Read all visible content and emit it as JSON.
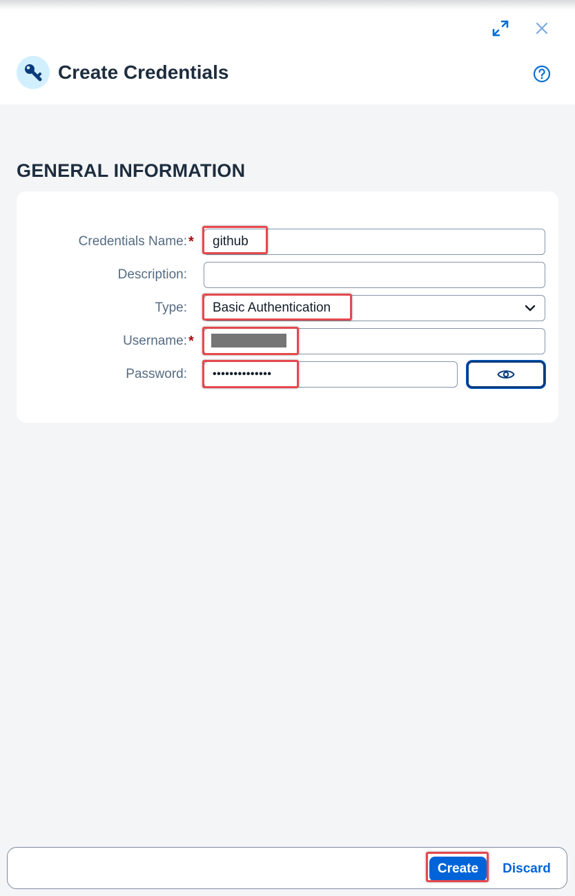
{
  "dialog": {
    "title": "Create Credentials",
    "icons": {
      "app": "key-icon",
      "expand": "expand-icon",
      "close": "close-icon",
      "help": "help-icon"
    }
  },
  "section": {
    "title": "GENERAL INFORMATION"
  },
  "form": {
    "credentials_name": {
      "label": "Credentials Name:",
      "required": "*",
      "value": "github"
    },
    "description": {
      "label": "Description:",
      "value": ""
    },
    "type": {
      "label": "Type:",
      "value": "Basic Authentication"
    },
    "username": {
      "label": "Username:",
      "required": "*"
    },
    "password": {
      "label": "Password:",
      "value_masked": "••••••••••••••"
    }
  },
  "footer": {
    "create_label": "Create",
    "discard_label": "Discard"
  },
  "colors": {
    "accent": "#0064d9",
    "highlight": "#e5484d",
    "required": "#aa0808"
  }
}
